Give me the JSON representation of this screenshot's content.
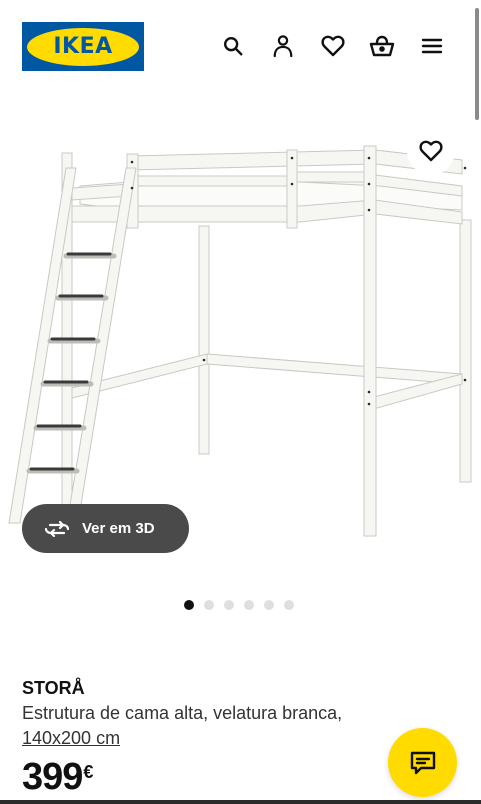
{
  "header": {
    "logo_text": "IKEA",
    "icons": [
      "search-icon",
      "user-icon",
      "heart-icon",
      "basket-icon",
      "menu-icon"
    ]
  },
  "gallery": {
    "view_3d_label": "Ver em 3D",
    "favourite_icon": "heart-icon",
    "image_count": 6,
    "active_image": 1
  },
  "product": {
    "name": "STORÅ",
    "description": "Estrutura de cama alta, velatura branca,",
    "size_link": "140x200 cm",
    "price_value": "399",
    "price_currency": "€"
  },
  "chat": {
    "icon": "chat-icon"
  },
  "colors": {
    "ikea_blue": "#0058a3",
    "ikea_yellow": "#ffdb00",
    "pill_bg": "#4a4a4a"
  }
}
